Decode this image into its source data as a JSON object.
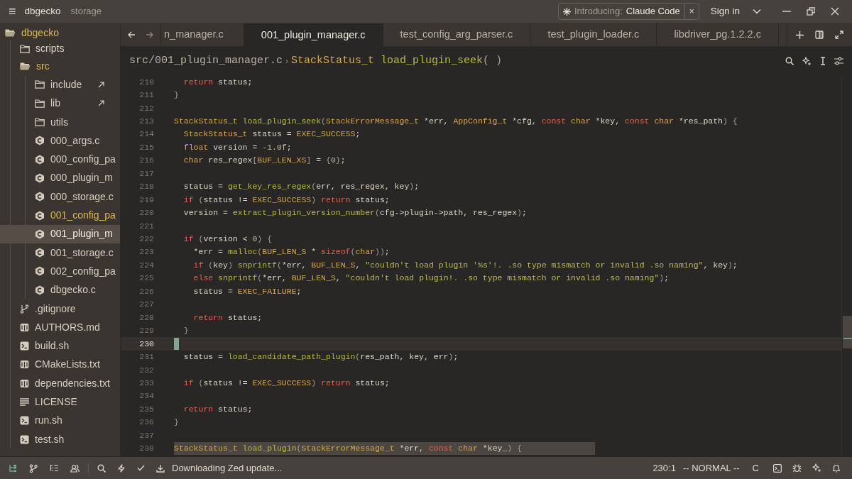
{
  "window": {
    "menu_icon": "≡",
    "project": "dbgecko",
    "branch": "storage"
  },
  "announcement": {
    "prefix": "Introducing:",
    "title": "Claude Code",
    "close": "×"
  },
  "account": {
    "label": "Sign in"
  },
  "project_panel": {
    "items": [
      {
        "label": "dbgecko",
        "kind": "folder",
        "expanded": true,
        "modified": true,
        "selected": false,
        "children": [
          {
            "label": "scripts",
            "kind": "folder",
            "expanded": false,
            "modified": false,
            "selected": false
          },
          {
            "label": "src",
            "kind": "folder",
            "expanded": true,
            "modified": true,
            "selected": false,
            "children": [
              {
                "label": "include",
                "kind": "folder",
                "expanded": false,
                "modified": false,
                "selected": false,
                "linked": true
              },
              {
                "label": "lib",
                "kind": "folder",
                "expanded": false,
                "modified": false,
                "selected": false,
                "linked": true
              },
              {
                "label": "utils",
                "kind": "folder",
                "expanded": false,
                "modified": false,
                "selected": false
              },
              {
                "label": "000_args.c",
                "kind": "c",
                "modified": false,
                "selected": false
              },
              {
                "label": "000_config_pa",
                "kind": "c",
                "modified": false,
                "selected": false
              },
              {
                "label": "000_plugin_m",
                "kind": "c",
                "modified": false,
                "selected": false
              },
              {
                "label": "000_storage.c",
                "kind": "c",
                "modified": false,
                "selected": false
              },
              {
                "label": "001_config_pa",
                "kind": "c",
                "modified": true,
                "selected": false
              },
              {
                "label": "001_plugin_m",
                "kind": "c",
                "modified": false,
                "selected": true
              },
              {
                "label": "001_storage.c",
                "kind": "c",
                "modified": false,
                "selected": false
              },
              {
                "label": "002_config_pa",
                "kind": "c",
                "modified": false,
                "selected": false
              },
              {
                "label": "dbgecko.c",
                "kind": "c",
                "modified": false,
                "selected": false
              }
            ]
          },
          {
            "label": ".gitignore",
            "kind": "git",
            "modified": false,
            "selected": false
          },
          {
            "label": "AUTHORS.md",
            "kind": "book",
            "modified": false,
            "selected": false
          },
          {
            "label": "build.sh",
            "kind": "terminal",
            "modified": false,
            "selected": false
          },
          {
            "label": "CMakeLists.txt",
            "kind": "book",
            "modified": false,
            "selected": false
          },
          {
            "label": "dependencies.txt",
            "kind": "book",
            "modified": false,
            "selected": false
          },
          {
            "label": "LICENSE",
            "kind": "text",
            "modified": false,
            "selected": false
          },
          {
            "label": "run.sh",
            "kind": "terminal",
            "modified": false,
            "selected": false
          },
          {
            "label": "test.sh",
            "kind": "terminal",
            "modified": false,
            "selected": false
          }
        ]
      }
    ]
  },
  "tabs": [
    {
      "label": "n_manager.c",
      "selected": false
    },
    {
      "label": "001_plugin_manager.c",
      "selected": true
    },
    {
      "label": "test_config_arg_parser.c",
      "selected": false
    },
    {
      "label": "test_plugin_loader.c",
      "selected": false
    },
    {
      "label": "libdriver_pg.1.2.2.c",
      "selected": false
    }
  ],
  "breadcrumb": {
    "path": "src/001_plugin_manager.c",
    "separator": "›",
    "symbol": [
      {
        "kind": "type",
        "text": "StackStatus_t"
      },
      {
        "kind": "fn",
        "text": " load_plugin_seek"
      },
      {
        "kind": "punct",
        "text": "( )"
      }
    ]
  },
  "editor": {
    "lines": [
      {
        "number": "210",
        "current": false,
        "highlighted": false,
        "tokens": [
          {
            "kind": "kw",
            "text": "  return"
          },
          {
            "kind": "plain",
            "text": " status;"
          }
        ]
      },
      {
        "number": "211",
        "current": false,
        "highlighted": false,
        "tokens": [
          {
            "kind": "punct",
            "text": "}"
          }
        ]
      },
      {
        "number": "212",
        "current": false,
        "highlighted": false
      },
      {
        "number": "213",
        "current": false,
        "highlighted": false,
        "tokens": [
          {
            "kind": "type",
            "text": "StackStatus_t"
          },
          {
            "kind": "fn",
            "text": " load_plugin_seek"
          },
          {
            "kind": "punct",
            "text": "("
          },
          {
            "kind": "type",
            "text": "StackErrorMessage_t"
          },
          {
            "kind": "plain",
            "text": " *err, "
          },
          {
            "kind": "type",
            "text": "AppConfig_t"
          },
          {
            "kind": "plain",
            "text": " *cfg, "
          },
          {
            "kind": "kw",
            "text": "const"
          },
          {
            "kind": "type",
            "text": " char"
          },
          {
            "kind": "plain",
            "text": " *key, "
          },
          {
            "kind": "kw",
            "text": "const"
          },
          {
            "kind": "type",
            "text": " char"
          },
          {
            "kind": "plain",
            "text": " *res_path"
          },
          {
            "kind": "punct",
            "text": ") {"
          }
        ]
      },
      {
        "number": "214",
        "current": false,
        "highlighted": false,
        "tokens": [
          {
            "kind": "type",
            "text": "  StackStatus_t"
          },
          {
            "kind": "plain",
            "text": " status = "
          },
          {
            "kind": "type",
            "text": "EXEC_SUCCESS"
          },
          {
            "kind": "plain",
            "text": ";"
          }
        ]
      },
      {
        "number": "215",
        "current": false,
        "highlighted": false,
        "tokens": [
          {
            "kind": "type",
            "text": "  float"
          },
          {
            "kind": "plain",
            "text": " version = "
          },
          {
            "kind": "num",
            "text": "-1.0f"
          },
          {
            "kind": "plain",
            "text": ";"
          }
        ]
      },
      {
        "number": "216",
        "current": false,
        "highlighted": false,
        "tokens": [
          {
            "kind": "type",
            "text": "  char"
          },
          {
            "kind": "plain",
            "text": " res_regex"
          },
          {
            "kind": "punct",
            "text": "["
          },
          {
            "kind": "type",
            "text": "BUF_LEN_XS"
          },
          {
            "kind": "punct",
            "text": "]"
          },
          {
            "kind": "plain",
            "text": " = "
          },
          {
            "kind": "punct",
            "text": "{"
          },
          {
            "kind": "num",
            "text": "0"
          },
          {
            "kind": "punct",
            "text": "}"
          },
          {
            "kind": "plain",
            "text": ";"
          }
        ]
      },
      {
        "number": "217",
        "current": false,
        "highlighted": false
      },
      {
        "number": "218",
        "current": false,
        "highlighted": false,
        "tokens": [
          {
            "kind": "plain",
            "text": "  status = "
          },
          {
            "kind": "fn",
            "text": "get_key_res_regex"
          },
          {
            "kind": "punct",
            "text": "("
          },
          {
            "kind": "plain",
            "text": "err, res_regex, key"
          },
          {
            "kind": "punct",
            "text": ")"
          },
          {
            "kind": "plain",
            "text": ";"
          }
        ]
      },
      {
        "number": "219",
        "current": false,
        "highlighted": false,
        "tokens": [
          {
            "kind": "kw",
            "text": "  if"
          },
          {
            "kind": "punct",
            "text": " ("
          },
          {
            "kind": "plain",
            "text": "status != "
          },
          {
            "kind": "type",
            "text": "EXEC_SUCCESS"
          },
          {
            "kind": "punct",
            "text": ")"
          },
          {
            "kind": "kw",
            "text": " return"
          },
          {
            "kind": "plain",
            "text": " status;"
          }
        ]
      },
      {
        "number": "220",
        "current": false,
        "highlighted": false,
        "tokens": [
          {
            "kind": "plain",
            "text": "  version = "
          },
          {
            "kind": "fn",
            "text": "extract_plugin_version_number"
          },
          {
            "kind": "punct",
            "text": "("
          },
          {
            "kind": "plain",
            "text": "cfg->plugin->path, res_regex"
          },
          {
            "kind": "punct",
            "text": ")"
          },
          {
            "kind": "plain",
            "text": ";"
          }
        ]
      },
      {
        "number": "221",
        "current": false,
        "highlighted": false
      },
      {
        "number": "222",
        "current": false,
        "highlighted": false,
        "tokens": [
          {
            "kind": "kw",
            "text": "  if"
          },
          {
            "kind": "punct",
            "text": " ("
          },
          {
            "kind": "plain",
            "text": "version < "
          },
          {
            "kind": "num",
            "text": "0"
          },
          {
            "kind": "punct",
            "text": ") {"
          }
        ]
      },
      {
        "number": "223",
        "current": false,
        "highlighted": false,
        "tokens": [
          {
            "kind": "plain",
            "text": "    *err = "
          },
          {
            "kind": "fn",
            "text": "malloc"
          },
          {
            "kind": "punct",
            "text": "("
          },
          {
            "kind": "type",
            "text": "BUF_LEN_S"
          },
          {
            "kind": "plain",
            "text": " * "
          },
          {
            "kind": "kw",
            "text": "sizeof"
          },
          {
            "kind": "punct",
            "text": "("
          },
          {
            "kind": "type",
            "text": "char"
          },
          {
            "kind": "punct",
            "text": "))"
          },
          {
            "kind": "plain",
            "text": ";"
          }
        ]
      },
      {
        "number": "224",
        "current": false,
        "highlighted": false,
        "tokens": [
          {
            "kind": "kw",
            "text": "    if"
          },
          {
            "kind": "punct",
            "text": " ("
          },
          {
            "kind": "plain",
            "text": "key"
          },
          {
            "kind": "punct",
            "text": ")"
          },
          {
            "kind": "fn",
            "text": " snprintf"
          },
          {
            "kind": "punct",
            "text": "("
          },
          {
            "kind": "plain",
            "text": "*err, "
          },
          {
            "kind": "type",
            "text": "BUF_LEN_S"
          },
          {
            "kind": "plain",
            "text": ", "
          },
          {
            "kind": "str",
            "text": "\"couldn't load plugin '%s'!. .so type mismatch or invalid .so naming\""
          },
          {
            "kind": "plain",
            "text": ", key"
          },
          {
            "kind": "punct",
            "text": ")"
          },
          {
            "kind": "plain",
            "text": ";"
          }
        ]
      },
      {
        "number": "225",
        "current": false,
        "highlighted": false,
        "tokens": [
          {
            "kind": "kw",
            "text": "    else"
          },
          {
            "kind": "fn",
            "text": " snprintf"
          },
          {
            "kind": "punct",
            "text": "("
          },
          {
            "kind": "plain",
            "text": "*err, "
          },
          {
            "kind": "type",
            "text": "BUF_LEN_S"
          },
          {
            "kind": "plain",
            "text": ", "
          },
          {
            "kind": "str",
            "text": "\"couldn't load plugin!. .so type mismatch or invalid .so naming\""
          },
          {
            "kind": "punct",
            "text": ")"
          },
          {
            "kind": "plain",
            "text": ";"
          }
        ]
      },
      {
        "number": "226",
        "current": false,
        "highlighted": false,
        "tokens": [
          {
            "kind": "plain",
            "text": "    status = "
          },
          {
            "kind": "type",
            "text": "EXEC_FAILURE"
          },
          {
            "kind": "plain",
            "text": ";"
          }
        ]
      },
      {
        "number": "227",
        "current": false,
        "highlighted": false
      },
      {
        "number": "228",
        "current": false,
        "highlighted": false,
        "tokens": [
          {
            "kind": "kw",
            "text": "    return"
          },
          {
            "kind": "plain",
            "text": " status;"
          }
        ]
      },
      {
        "number": "229",
        "current": false,
        "highlighted": false,
        "tokens": [
          {
            "kind": "punct",
            "text": "  }"
          }
        ]
      },
      {
        "number": "230",
        "current": true,
        "highlighted": false
      },
      {
        "number": "231",
        "current": false,
        "highlighted": false,
        "tokens": [
          {
            "kind": "plain",
            "text": "  status = "
          },
          {
            "kind": "fn",
            "text": "load_candidate_path_plugin"
          },
          {
            "kind": "punct",
            "text": "("
          },
          {
            "kind": "plain",
            "text": "res_path, key, err"
          },
          {
            "kind": "punct",
            "text": ")"
          },
          {
            "kind": "plain",
            "text": ";"
          }
        ]
      },
      {
        "number": "232",
        "current": false,
        "highlighted": false
      },
      {
        "number": "233",
        "current": false,
        "highlighted": false,
        "tokens": [
          {
            "kind": "kw",
            "text": "  if"
          },
          {
            "kind": "punct",
            "text": " ("
          },
          {
            "kind": "plain",
            "text": "status != "
          },
          {
            "kind": "type",
            "text": "EXEC_SUCCESS"
          },
          {
            "kind": "punct",
            "text": ")"
          },
          {
            "kind": "kw",
            "text": " return"
          },
          {
            "kind": "plain",
            "text": " status;"
          }
        ]
      },
      {
        "number": "234",
        "current": false,
        "highlighted": false
      },
      {
        "number": "235",
        "current": false,
        "highlighted": false,
        "tokens": [
          {
            "kind": "kw",
            "text": "  return"
          },
          {
            "kind": "plain",
            "text": " status;"
          }
        ]
      },
      {
        "number": "236",
        "current": false,
        "highlighted": false,
        "tokens": [
          {
            "kind": "punct",
            "text": "}"
          }
        ]
      },
      {
        "number": "237",
        "current": false,
        "highlighted": false
      },
      {
        "number": "238",
        "current": false,
        "highlighted": true,
        "tokens": [
          {
            "kind": "type",
            "text": "StackStatus_t"
          },
          {
            "kind": "fn",
            "text": " load_plugin"
          },
          {
            "kind": "punct",
            "text": "("
          },
          {
            "kind": "type",
            "text": "StackErrorMessage_t"
          },
          {
            "kind": "plain",
            "text": " *err, "
          },
          {
            "kind": "kw",
            "text": "const"
          },
          {
            "kind": "type",
            "text": " char"
          },
          {
            "kind": "plain",
            "text": " *key_"
          },
          {
            "kind": "punct",
            "text": ") {"
          }
        ]
      }
    ]
  },
  "status_bar": {
    "message": "Downloading Zed update...",
    "cursor": "230:1",
    "mode": "-- NORMAL --",
    "language": "C"
  }
}
